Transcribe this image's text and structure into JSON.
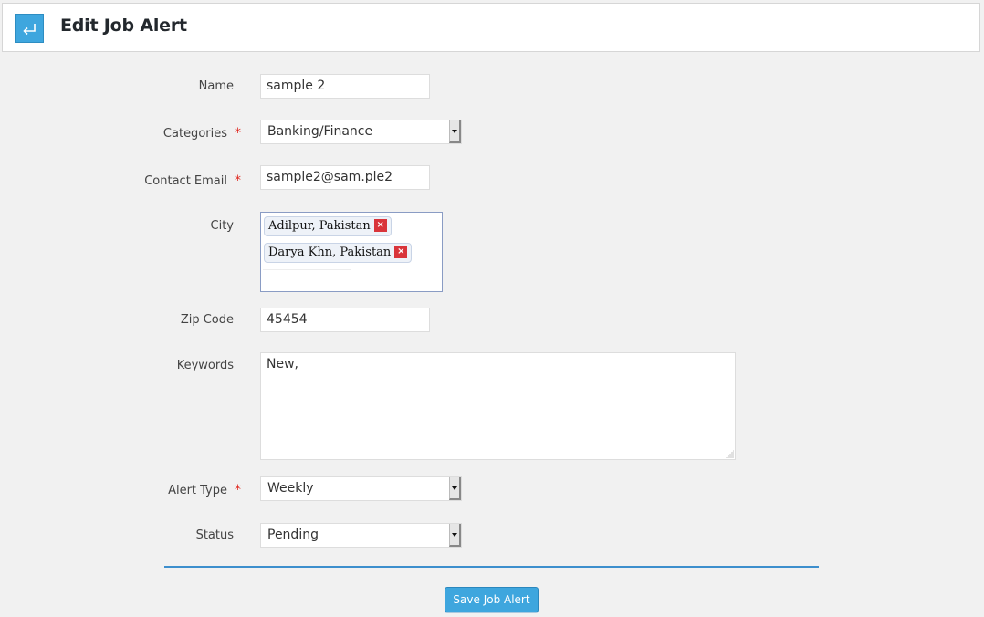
{
  "header": {
    "back_icon": "arrow-return-left-icon",
    "title": "Edit Job Alert"
  },
  "form": {
    "name": {
      "label": "Name",
      "value": "sample 2",
      "required": false
    },
    "categories": {
      "label": "Categories",
      "value": "Banking/Finance",
      "required": true
    },
    "contact_email": {
      "label": "Contact Email",
      "value": "sample2@sam.ple2",
      "required": true
    },
    "city": {
      "label": "City",
      "tags": [
        "Adilpur, Pakistan",
        "Darya Khn, Pakistan"
      ],
      "remove_glyph": "×",
      "required": false
    },
    "zip_code": {
      "label": "Zip Code",
      "value": "45454",
      "required": false
    },
    "keywords": {
      "label": "Keywords",
      "value": "New,",
      "required": false
    },
    "alert_type": {
      "label": "Alert Type",
      "value": "Weekly",
      "required": true
    },
    "status": {
      "label": "Status",
      "value": "Pending",
      "required": false
    },
    "required_marker": "*"
  },
  "actions": {
    "save_label": "Save Job Alert"
  },
  "colors": {
    "accent": "#3ea6de",
    "required": "#e0271f",
    "divider": "#3d8fcd",
    "tag_remove": "#d9343a"
  }
}
